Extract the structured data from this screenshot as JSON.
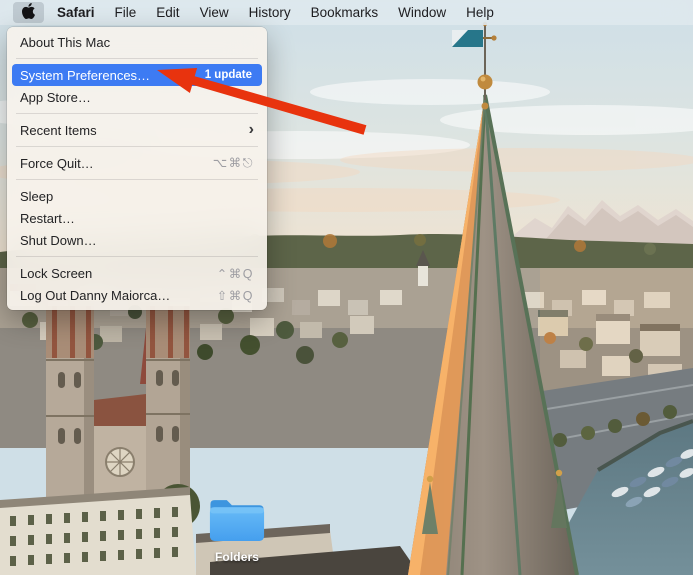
{
  "menu_bar": {
    "app_name": "Safari",
    "items": [
      "File",
      "Edit",
      "View",
      "History",
      "Bookmarks",
      "Window",
      "Help"
    ]
  },
  "apple_menu": {
    "items": [
      {
        "label": "About This Mac"
      },
      {
        "label": "System Preferences…",
        "badge": "1 update",
        "highlighted": true
      },
      {
        "label": "App Store…"
      },
      {
        "label": "Recent Items",
        "submenu_chevron": "›"
      },
      {
        "label": "Force Quit…",
        "shortcut": "⌥⌘⎋"
      },
      {
        "label": "Sleep"
      },
      {
        "label": "Restart…"
      },
      {
        "label": "Shut Down…"
      },
      {
        "label": "Lock Screen",
        "shortcut": "⌃⌘Q"
      },
      {
        "label": "Log Out Danny Maiorca…",
        "shortcut": "⇧⌘Q"
      }
    ]
  },
  "desktop": {
    "folder_label": "Folders"
  },
  "colors": {
    "menu_highlight": "#3d7bf3",
    "annotation_arrow": "#e8330e",
    "folder_blue": "#53acf0",
    "menubar_bg": "#e1e9ee"
  }
}
